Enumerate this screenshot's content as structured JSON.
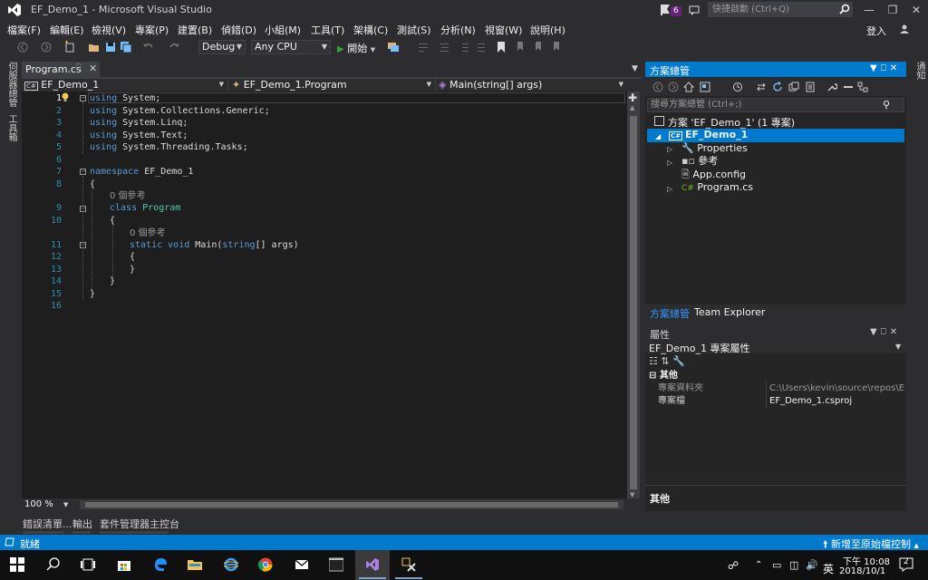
{
  "window": {
    "title": "EF_Demo_1 - Microsoft Visual Studio",
    "notification_count": "6",
    "quick_launch_placeholder": "快捷啟動 (Ctrl+Q)",
    "sign_in": "登入"
  },
  "menu": [
    "檔案(F)",
    "編輯(E)",
    "檢視(V)",
    "專案(P)",
    "建置(B)",
    "偵錯(D)",
    "小組(M)",
    "工具(T)",
    "架構(C)",
    "測試(S)",
    "分析(N)",
    "視窗(W)",
    "說明(H)"
  ],
  "toolbar": {
    "config": "Debug",
    "platform": "Any CPU",
    "start_label": "開始"
  },
  "left_tabs": [
    "伺服器總管",
    "工具箱"
  ],
  "right_tabs": [
    "通知"
  ],
  "editor": {
    "tab_name": "Program.cs",
    "nav_project": "EF_Demo_1",
    "nav_class": "EF_Demo_1.Program",
    "nav_member": "Main(string[] args)",
    "line_numbers": [
      "1",
      "2",
      "3",
      "4",
      "5",
      "6",
      "7",
      "8",
      "9",
      "10",
      "11",
      "12",
      "13",
      "14",
      "15",
      "16"
    ],
    "code": {
      "l1_kw": "using",
      "l1_rest": " System;",
      "l2_kw": "using",
      "l2_rest": " System.Collections.Generic;",
      "l3_kw": "using",
      "l3_rest": " System.Linq;",
      "l4_kw": "using",
      "l4_rest": " System.Text;",
      "l5_kw": "using",
      "l5_rest": " System.Threading.Tasks;",
      "l7_kw": "namespace",
      "l7_rest": " EF_Demo_1",
      "l8": "{",
      "ref1": "0 個參考",
      "l9_kw": "class",
      "l9_ty": "Program",
      "l10": "{",
      "ref2": "0 個參考",
      "l11_kw1": "static",
      "l11_kw2": "void",
      "l11_name": " Main(",
      "l11_kw3": "string",
      "l11_rest": "[] args)",
      "l12": "{",
      "l13": "}",
      "l14": "}",
      "l15": "}"
    },
    "zoom": "100 %"
  },
  "bottom_tabs": [
    "錯誤清單...",
    "輸出",
    "套件管理器主控台"
  ],
  "status": {
    "text": "就緒",
    "publish": "新增至原始檔控制"
  },
  "solution_explorer": {
    "title": "方案總管",
    "search_placeholder": "搜尋方案總管 (Ctrl+;)",
    "solution": "方案 'EF_Demo_1' (1 專案)",
    "project": "EF_Demo_1",
    "items": [
      "Properties",
      "參考",
      "App.config",
      "Program.cs"
    ],
    "tabs": [
      "方案總管",
      "Team Explorer"
    ]
  },
  "properties": {
    "title": "屬性",
    "object": "EF_Demo_1 專案屬性",
    "category": "其他",
    "rows": [
      {
        "name": "專案資料夾",
        "value": "C:\\Users\\kevin\\source\\repos\\EF_"
      },
      {
        "name": "專案檔",
        "value": "EF_Demo_1.csproj"
      }
    ],
    "description_title": "其他"
  },
  "taskbar": {
    "ime": "英",
    "time": "下午 10:08",
    "date": "2018/10/1",
    "notif": "2"
  },
  "colors": {
    "accent": "#007acc",
    "keyword": "#569cd6",
    "type": "#4ec9b0",
    "line_number": "#2b91af"
  }
}
